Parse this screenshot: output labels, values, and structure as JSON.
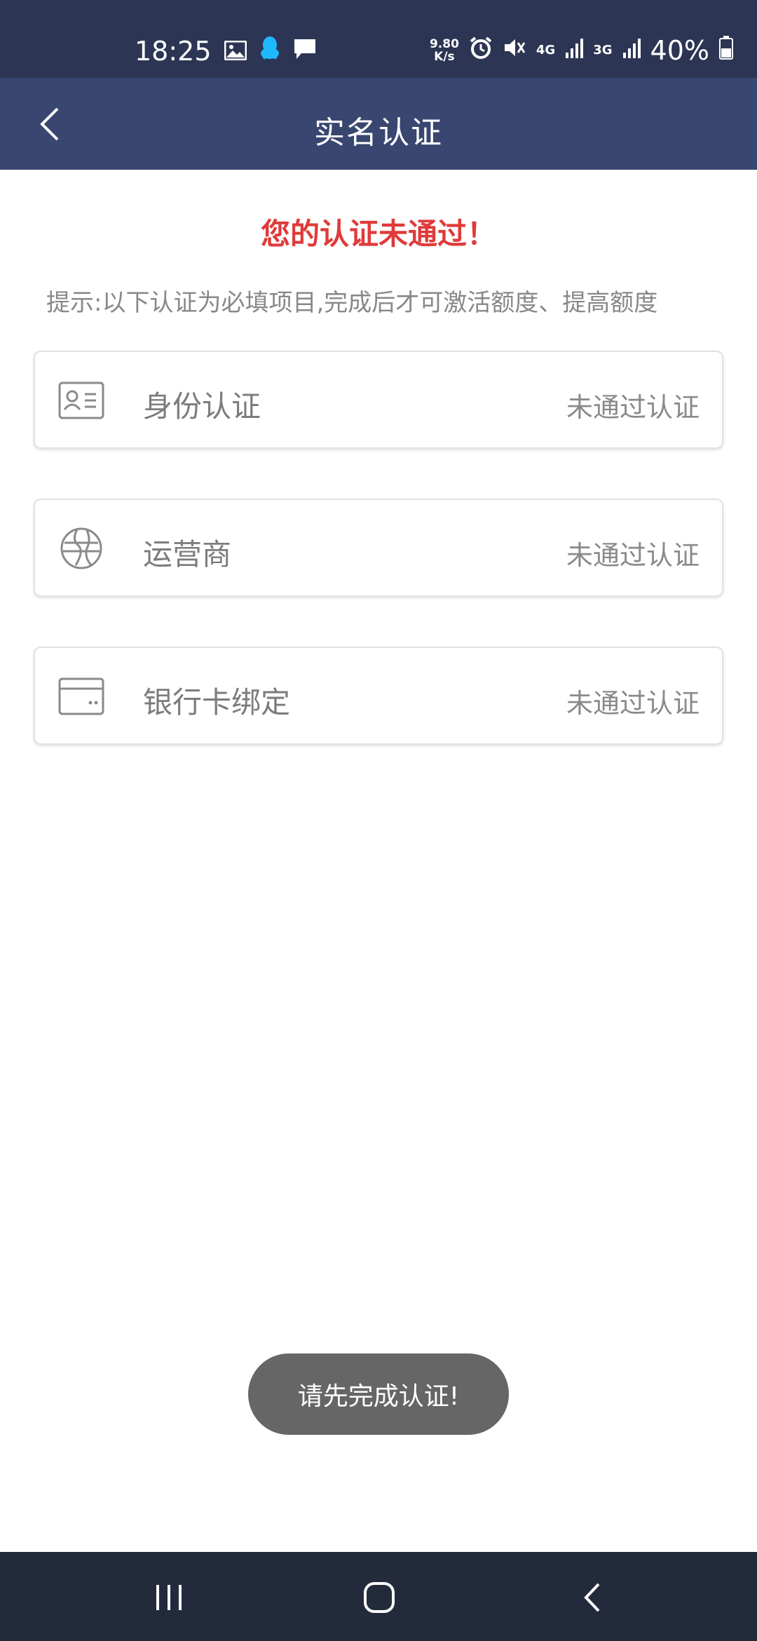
{
  "status_bar": {
    "time": "18:25",
    "net_speed_value": "9.80",
    "net_speed_unit": "K/s",
    "net_4g": "4G",
    "net_3g": "3G",
    "battery": "40%",
    "icons": [
      "image-icon",
      "qq-icon",
      "message-icon",
      "alarm-icon",
      "mute-icon",
      "signal-icon",
      "battery-icon"
    ]
  },
  "header": {
    "title": "实名认证"
  },
  "notice": "您的认证未通过！",
  "hint": "提示:以下认证为必填项目,完成后才可激活额度、提高额度",
  "items": [
    {
      "label": "身份认证",
      "status": "未通过认证",
      "icon": "id-card-icon"
    },
    {
      "label": "运营商",
      "status": "未通过认证",
      "icon": "globe-icon"
    },
    {
      "label": "银行卡绑定",
      "status": "未通过认证",
      "icon": "bank-card-icon"
    }
  ],
  "toast": "请先完成认证!",
  "colors": {
    "header_bg": "#394670",
    "status_bg": "#2c3553",
    "notice_red": "#e03a3a",
    "nav_bg": "#232a3c",
    "toast_bg": "#666666"
  }
}
